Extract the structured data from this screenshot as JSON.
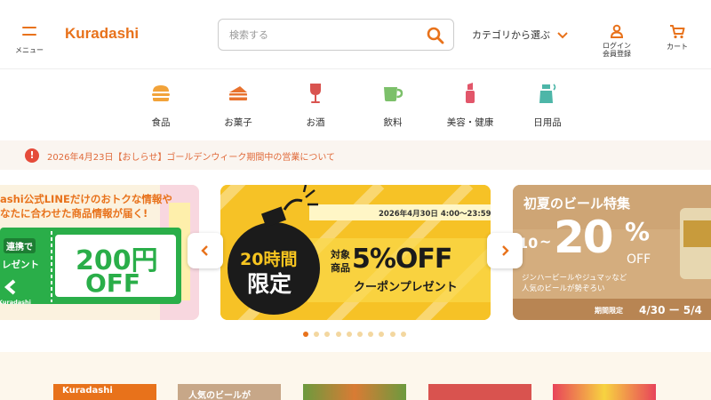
{
  "header": {
    "menu_label": "メニュー",
    "logo_text": "Kuradashi",
    "search_placeholder": "検索する",
    "category_label": "カテゴリから選ぶ",
    "login_label": "ログイン",
    "register_label": "会員登録",
    "cart_label": "カート",
    "accent_color": "#e8721b"
  },
  "categories": [
    {
      "label": "食品",
      "icon": "burger-icon",
      "color": "#f2a33a"
    },
    {
      "label": "お菓子",
      "icon": "cake-icon",
      "color": "#e8722e"
    },
    {
      "label": "お酒",
      "icon": "wine-glass-icon",
      "color": "#d9534f"
    },
    {
      "label": "飲料",
      "icon": "cup-icon",
      "color": "#7cc06a"
    },
    {
      "label": "美容・健康",
      "icon": "lipstick-icon",
      "color": "#e2566a"
    },
    {
      "label": "日用品",
      "icon": "spray-bottle-icon",
      "color": "#4db6a8"
    }
  ],
  "notice": {
    "icon": "alert-icon",
    "text": "2026年4月23日【おしらせ】ゴールデンウィーク期間中の営業について"
  },
  "carousel": {
    "left_banner": {
      "line1": "ashi公式LINEだけのおトクな情報や",
      "line2": "なたに合わせた商品情報が届く!",
      "connect": "連携で",
      "present": "レゼント",
      "amount": "200円",
      "off": "OFF",
      "brand": "Kuradashi"
    },
    "center_banner": {
      "hours": "20時間",
      "limited": "限定",
      "date": "2026年4月30日 4:00〜23:59",
      "target1": "対象",
      "target2": "商品",
      "percent": "5%OFF",
      "coupon": "クーポンプレゼント"
    },
    "right_banner": {
      "title": "初夏のビール特集",
      "range_from": "10",
      "range_sep": "~",
      "range_to": "20",
      "pct": "%",
      "off": "OFF",
      "sub1": "ジンハービールやジュマッなど",
      "sub2": "人気のビールが勢ぞろい",
      "period_label": "期間限定",
      "period": "4/30 ー 5/4"
    },
    "dots_count": 10,
    "active_dot": 0
  },
  "lower": {
    "tile1_text": "Kuradashi",
    "tile2_text": "人気のビールが"
  }
}
